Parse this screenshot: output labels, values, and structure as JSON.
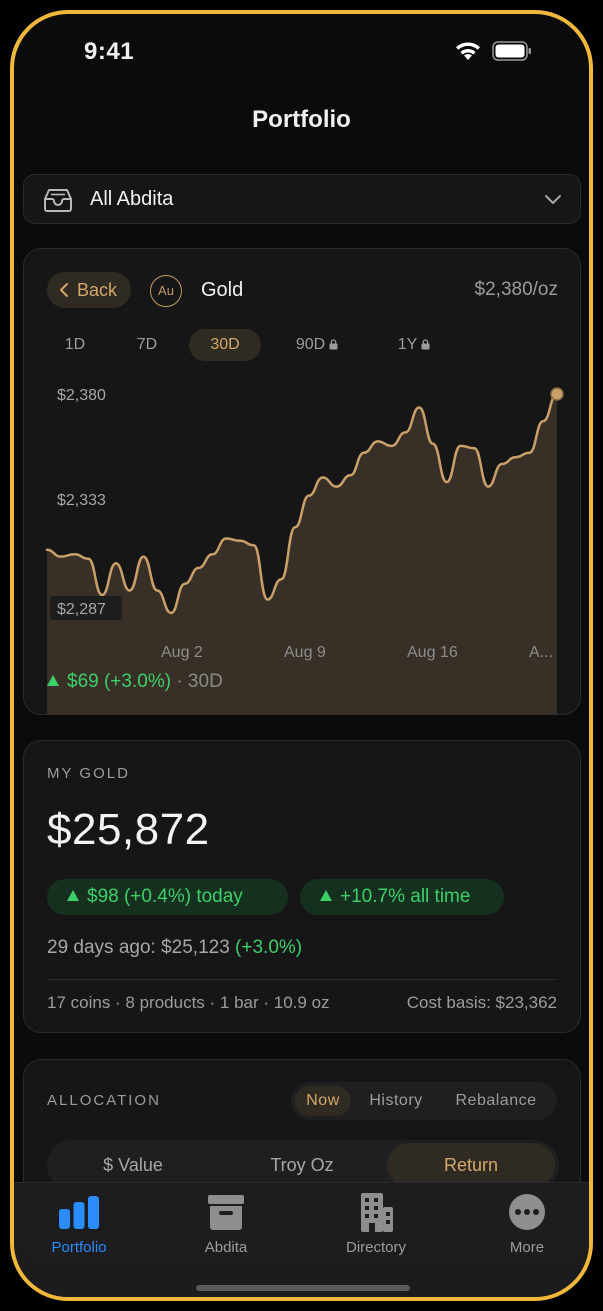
{
  "status_bar": {
    "time": "9:41"
  },
  "header": {
    "title": "Portfolio"
  },
  "account_selector": {
    "label": "All Abdita"
  },
  "metal_card": {
    "back_label": "Back",
    "symbol": "Au",
    "name": "Gold",
    "price_per_oz": "$2,380/oz",
    "ranges": [
      {
        "label": "1D",
        "locked": false
      },
      {
        "label": "7D",
        "locked": false
      },
      {
        "label": "30D",
        "locked": false,
        "active": true
      },
      {
        "label": "90D",
        "locked": true
      },
      {
        "label": "1Y",
        "locked": true
      }
    ],
    "change_text": "$69 (+3.0%)",
    "change_period": "· 30D"
  },
  "chart_data": {
    "type": "area",
    "y_ticks": [
      "$2,380",
      "$2,333",
      "$2,287"
    ],
    "x_ticks": [
      "Aug 2",
      "Aug 9",
      "Aug 16",
      "A..."
    ],
    "ylim": [
      2287,
      2380
    ],
    "values": [
      2311,
      2308,
      2309,
      2307,
      2291,
      2305,
      2293,
      2308,
      2293,
      2283,
      2296,
      2303,
      2309,
      2316,
      2315,
      2313,
      2289,
      2298,
      2321,
      2335,
      2343,
      2339,
      2344,
      2354,
      2359,
      2357,
      2363,
      2374,
      2358,
      2341,
      2357,
      2356,
      2339,
      2349,
      2352,
      2354,
      2368,
      2380
    ],
    "color_line": "#c9a06a",
    "color_fill": "#3c3328",
    "grid": false
  },
  "my_gold": {
    "label": "MY GOLD",
    "value": "$25,872",
    "today": "$98 (+0.4%) today",
    "all_time": "+10.7% all time",
    "ago_text": "29 days ago: $25,123",
    "ago_change": "(+3.0%)",
    "summary": "17 coins · 8 products · 1 bar · 10.9 oz",
    "cost_basis": "Cost basis: $23,362"
  },
  "allocation": {
    "label": "ALLOCATION",
    "tabs": [
      "Now",
      "History",
      "Rebalance"
    ],
    "segments": [
      "$ Value",
      "Troy Oz",
      "Return"
    ]
  },
  "tabbar": {
    "items": [
      {
        "label": "Portfolio",
        "icon": "bar-chart-icon",
        "active": true
      },
      {
        "label": "Abdita",
        "icon": "archive-box-icon"
      },
      {
        "label": "Directory",
        "icon": "building-icon"
      },
      {
        "label": "More",
        "icon": "ellipsis-circle-icon"
      }
    ],
    "active_color": "#2b8cff"
  }
}
